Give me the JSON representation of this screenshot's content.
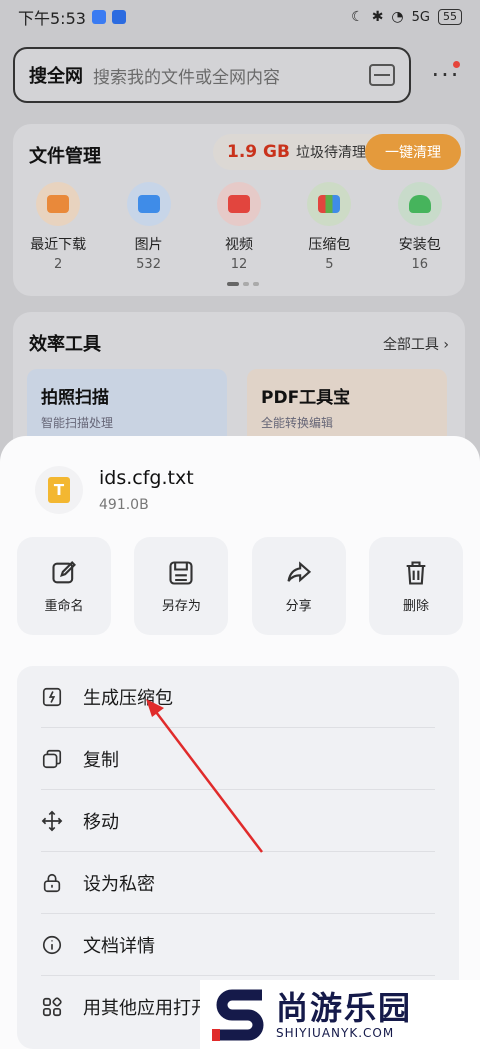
{
  "status_bar": {
    "time": "下午5:53",
    "network": "5G",
    "battery": "55"
  },
  "search": {
    "brand": "搜全网",
    "placeholder": "搜索我的文件或全网内容"
  },
  "file_management": {
    "title": "文件管理",
    "junk_size": "1.9 GB",
    "junk_text": "垃圾待清理",
    "clean_button": "一键清理",
    "items": [
      {
        "label": "最近下载",
        "count": "2",
        "icon": "download-icon",
        "color": "#e9893a"
      },
      {
        "label": "图片",
        "count": "532",
        "icon": "image-icon",
        "color": "#3f8ce8"
      },
      {
        "label": "视频",
        "count": "12",
        "icon": "video-icon",
        "color": "#e2453e"
      },
      {
        "label": "压缩包",
        "count": "5",
        "icon": "archive-icon",
        "color": "#5fae4b"
      },
      {
        "label": "安装包",
        "count": "16",
        "icon": "android-icon",
        "color": "#46b45c"
      }
    ]
  },
  "tools": {
    "title": "效率工具",
    "all_label": "全部工具",
    "tiles": [
      {
        "name": "拍照扫描",
        "sub": "智能扫描处理"
      },
      {
        "name": "PDF工具宝",
        "sub": "全能转换编辑"
      }
    ]
  },
  "sheet": {
    "file_name": "ids.cfg.txt",
    "file_size": "491.0B",
    "file_icon_letter": "T",
    "actions": [
      {
        "label": "重命名",
        "icon": "edit-icon"
      },
      {
        "label": "另存为",
        "icon": "save-icon"
      },
      {
        "label": "分享",
        "icon": "share-icon"
      },
      {
        "label": "删除",
        "icon": "trash-icon"
      }
    ],
    "menu": [
      {
        "label": "生成压缩包",
        "icon": "zip-icon"
      },
      {
        "label": "复制",
        "icon": "copy-icon"
      },
      {
        "label": "移动",
        "icon": "move-icon"
      },
      {
        "label": "设为私密",
        "icon": "lock-icon"
      },
      {
        "label": "文档详情",
        "icon": "info-icon"
      },
      {
        "label": "用其他应用打开",
        "icon": "apps-icon"
      }
    ]
  },
  "watermark": {
    "cn": "尚游乐园",
    "en": "SHIYIUANYK.COM"
  },
  "colors": {
    "accent_orange": "#e49a3c",
    "junk_red": "#c9321b",
    "annotation_arrow": "#e02b2b"
  }
}
